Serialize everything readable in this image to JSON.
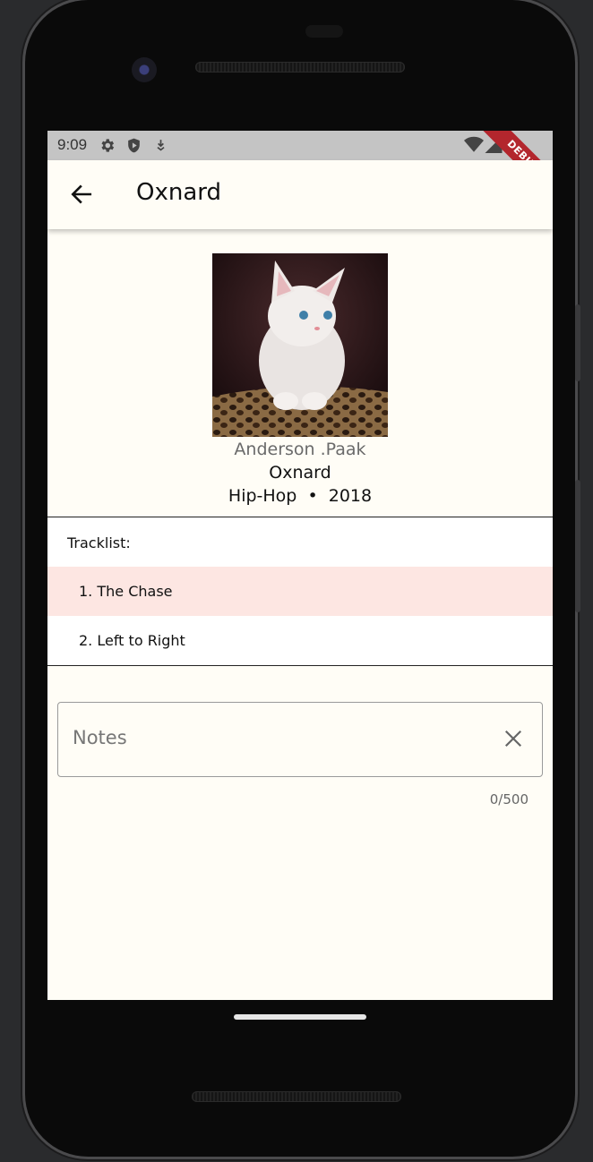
{
  "status_bar": {
    "time": "9:09",
    "icons": [
      "settings-gear-icon",
      "shield-play-icon",
      "download-arrow-icon",
      "wifi-icon",
      "cellular-signal-icon"
    ],
    "debug_banner": "DEBUG"
  },
  "app_bar": {
    "back_icon": "arrow-back-icon",
    "title": "Oxnard"
  },
  "album": {
    "cover_description": "kitten-photo",
    "artist": "Anderson .Paak",
    "title": "Oxnard",
    "genre_year": "Hip-Hop  •  2018"
  },
  "tracklist": {
    "header": "Tracklist:",
    "tracks": [
      {
        "label": "1. The Chase",
        "playing": true
      },
      {
        "label": "2. Left to Right",
        "playing": false
      }
    ],
    "highlight_color": "#fde6e2"
  },
  "notes": {
    "placeholder": "Notes",
    "value": "",
    "counter": "0/500",
    "clear_icon": "close-icon"
  },
  "colors": {
    "background": "#fffdf6",
    "status_bar": "#c4c4c4",
    "debug_banner": "#b3262d"
  }
}
